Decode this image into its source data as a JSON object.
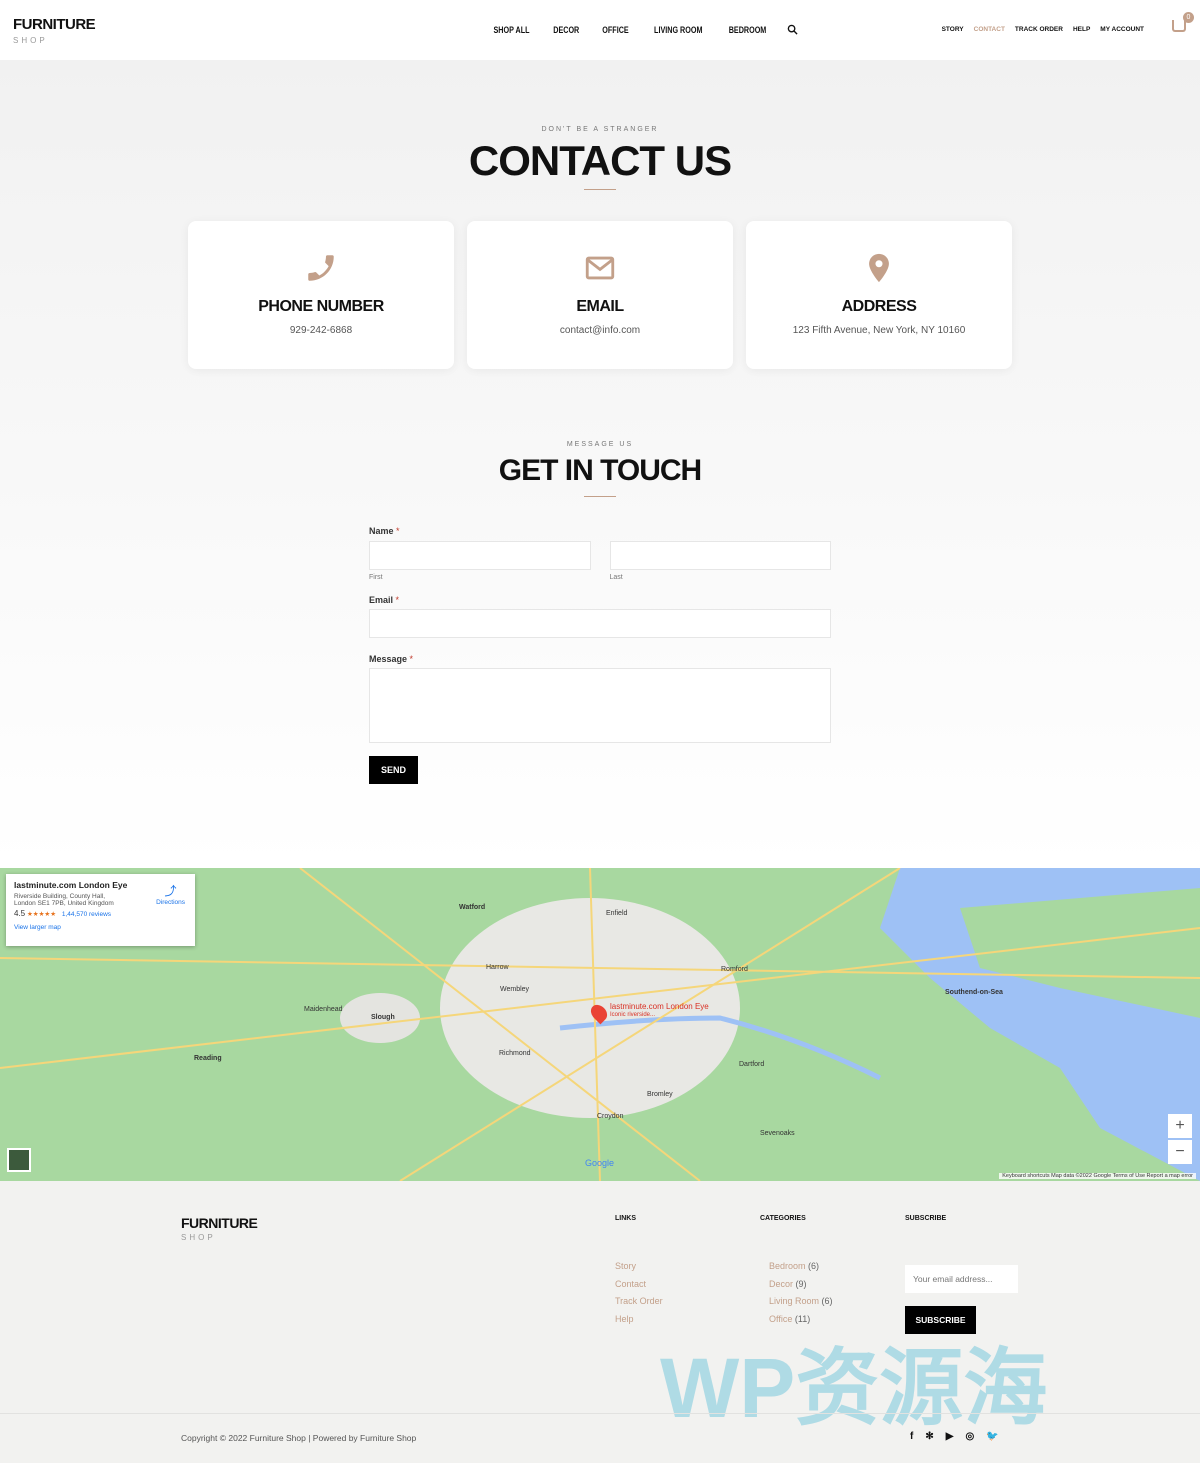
{
  "header": {
    "logo_title": "FURNITURE",
    "logo_sub": "SHOP",
    "nav": [
      "SHOP ALL",
      "DECOR",
      "OFFICE",
      "LIVING ROOM",
      "BEDROOM"
    ],
    "right_nav": [
      "STORY",
      "CONTACT",
      "TRACK ORDER",
      "HELP",
      "MY ACCOUNT"
    ],
    "cart_count": "0"
  },
  "contact": {
    "eyebrow": "DON'T BE A STRANGER",
    "title": "CONTACT US",
    "cards": [
      {
        "icon": "phone-icon",
        "title": "PHONE NUMBER",
        "value": "929-242-6868"
      },
      {
        "icon": "envelope-icon",
        "title": "EMAIL",
        "value": "contact@info.com"
      },
      {
        "icon": "map-pin-icon",
        "title": "ADDRESS",
        "value": "123 Fifth Avenue, New York, NY 10160"
      }
    ]
  },
  "form": {
    "eyebrow": "MESSAGE US",
    "title": "GET IN TOUCH",
    "name_label": "Name",
    "first_hint": "First",
    "last_hint": "Last",
    "email_label": "Email",
    "message_label": "Message",
    "required": "*",
    "send": "SEND"
  },
  "map": {
    "place": "lastminute.com London Eye",
    "address1": "Riverside Building, County Hall,",
    "address2": "London SE1 7PB, United Kingdom",
    "rating": "4.5",
    "stars": "★★★★★",
    "reviews": "1,44,570 reviews",
    "directions": "Directions",
    "larger": "View larger map",
    "marker_label": "lastminute.com London Eye",
    "marker_sub": "Iconic riverside...",
    "labels": [
      "Watford",
      "Enfield",
      "Harrow",
      "Wembley",
      "Slough",
      "Romford",
      "Southend-on-Sea",
      "Richmond",
      "Croydon",
      "Bromley",
      "Dartford",
      "Maidenhead",
      "Reading",
      "Sevenoaks"
    ],
    "attribution": "Keyboard shortcuts   Map data ©2022 Google   Terms of Use   Report a map error",
    "google": "Google"
  },
  "footer": {
    "logo_title": "FURNITURE",
    "logo_sub": "SHOP",
    "links_title": "LINKS",
    "links": [
      "Story",
      "Contact",
      "Track Order",
      "Help"
    ],
    "cat_title": "CATEGORIES",
    "cats": [
      {
        "name": "Bedroom",
        "count": "(6)"
      },
      {
        "name": "Decor",
        "count": "(9)"
      },
      {
        "name": "Living Room",
        "count": "(6)"
      },
      {
        "name": "Office",
        "count": "(11)"
      }
    ],
    "sub_title": "SUBSCRIBE",
    "email_placeholder": "Your email address...",
    "subscribe": "SUBSCRIBE",
    "copyright": "Copyright © 2022 Furniture Shop | Powered by Furniture Shop",
    "social": [
      "facebook-icon",
      "yelp-icon",
      "youtube-icon",
      "instagram-icon",
      "twitter-icon"
    ],
    "watermark": "WP资源海"
  },
  "colors": {
    "accent": "#c3a08a",
    "dark": "#000000"
  }
}
